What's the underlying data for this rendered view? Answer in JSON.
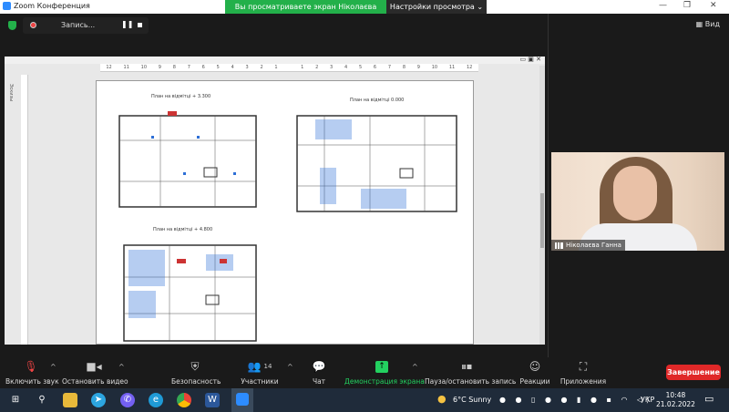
{
  "window": {
    "title": "Zoom Конференция",
    "banner": "Вы просматриваете экран Ніколаєва Ганна",
    "view_options": "Настройки просмотра ⌄",
    "minimize": "—",
    "restore": "❐",
    "close": "✕"
  },
  "recording": {
    "label": "Запись...",
    "pause": "❚❚"
  },
  "view_button": "Вид",
  "document": {
    "sidebar_tab": "Эскизы",
    "ruler": [
      "12",
      "11",
      "10",
      "9",
      "8",
      "7",
      "6",
      "5",
      "4",
      "3",
      "2",
      "1",
      "",
      "1",
      "2",
      "3",
      "4",
      "5",
      "6",
      "7",
      "8",
      "9",
      "10",
      "11",
      "12"
    ],
    "plans": [
      {
        "title": "План на відмітці + 3.300"
      },
      {
        "title": "План на відмітці  0.000"
      },
      {
        "title": "План на відмітці + 4.800"
      }
    ]
  },
  "participant": {
    "name": "Ніколаєва Ганна"
  },
  "controls": {
    "mute": "Включить звук",
    "video": "Остановить видео",
    "security": "Безопасность",
    "participants": "Участники",
    "participants_count": "14",
    "chat": "Чат",
    "share": "Демонстрация экрана",
    "record": "Пауза/остановить запись",
    "reactions": "Реакции",
    "apps": "Приложения",
    "end": "Завершение"
  },
  "taskbar": {
    "weather": "6°C  Sunny",
    "lang": "УКР",
    "time": "10:48",
    "date": "21.02.2022"
  },
  "colors": {
    "green": "#23b04a",
    "end": "#e02828",
    "accent": "#2d8cff"
  }
}
